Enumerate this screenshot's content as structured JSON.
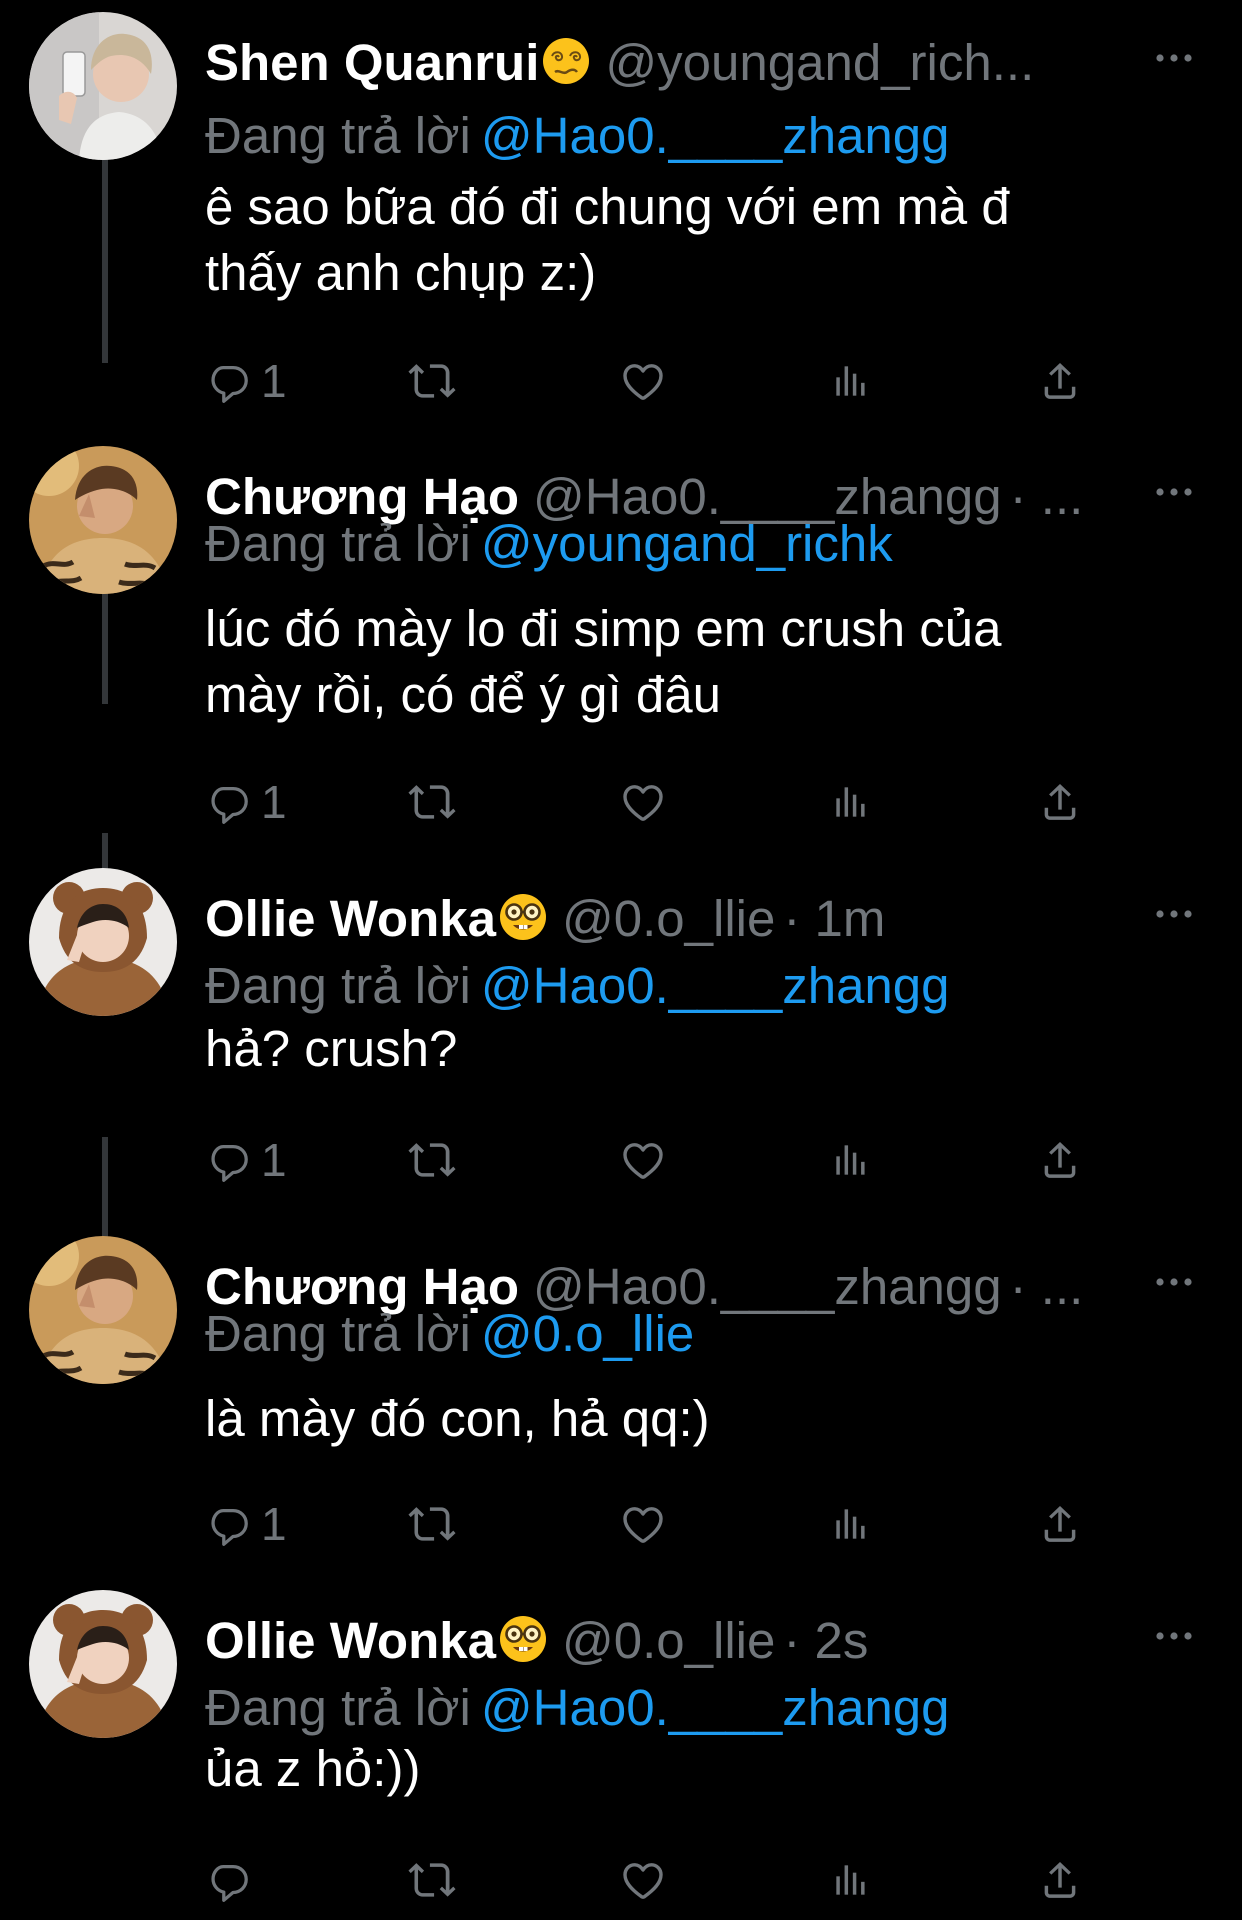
{
  "colors": {
    "background": "#000000",
    "text": "#ffffff",
    "secondary": "#71767b",
    "mention": "#1d9bf0",
    "thread_line": "#333639"
  },
  "tweets": [
    {
      "name": "Shen Quanrui",
      "name_emoji": "woozy-face-emoji",
      "handle": "@youngand_rich...",
      "meta": "",
      "reply_label": "Đang trả lời",
      "reply_to": "@Hao0.____zhangg",
      "text": "ê sao bữa đó đi chung với em mà đ\nthấy anh chụp z:)",
      "reply_count": "1"
    },
    {
      "name": "Chương Hạo",
      "name_emoji": "",
      "handle": "@Hao0.____zhangg",
      "meta": "· ...",
      "reply_label": "Đang trả lời",
      "reply_to": "@youngand_richk",
      "text": "lúc đó mày lo đi simp em crush của\nmày rồi, có để ý gì đâu",
      "reply_count": "1"
    },
    {
      "name": "Ollie Wonka",
      "name_emoji": "nerd-face-emoji",
      "handle": "@0.o_llie",
      "meta": "· 1m",
      "reply_label": "Đang trả lời",
      "reply_to": "@Hao0.____zhangg",
      "text": "hả? crush?",
      "reply_count": "1"
    },
    {
      "name": "Chương Hạo",
      "name_emoji": "",
      "handle": "@Hao0.____zhangg",
      "meta": "· ...",
      "reply_label": "Đang trả lời",
      "reply_to": "@0.o_llie",
      "text": "là mày đó con, hả qq:)",
      "reply_count": "1"
    },
    {
      "name": "Ollie Wonka",
      "name_emoji": "nerd-face-emoji",
      "handle": "@0.o_llie",
      "meta": "· 2s",
      "reply_label": "Đang trả lời",
      "reply_to": "@Hao0.____zhangg",
      "text": "ủa z hỏ:))",
      "reply_count": ""
    }
  ],
  "icons": {
    "reply": "reply-icon",
    "retweet": "retweet-icon",
    "like": "heart-icon",
    "views": "analytics-icon",
    "share": "share-icon",
    "more": "more-icon"
  }
}
